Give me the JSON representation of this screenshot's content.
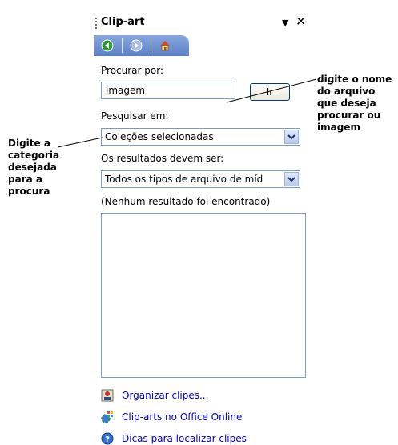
{
  "pane": {
    "title": "Clip-art",
    "dropdown_arrow": "▼",
    "close": "✕",
    "nav": [
      "back-icon",
      "forward-icon",
      "home-icon"
    ],
    "search_for_label": "Procurar por:",
    "search_for_value": "imagem",
    "go_label": "Ir",
    "search_in_label": "Pesquisar em:",
    "search_in_value": "Coleções selecionadas",
    "results_type_label": "Os resultados devem ser:",
    "results_type_value": "Todos os tipos de arquivo de míd",
    "status": "(Nenhum resultado foi encontrado)",
    "links": [
      {
        "label": "Organizar clipes...",
        "icon": "organize-clips-icon"
      },
      {
        "label": "Clip-arts no Office Online",
        "icon": "office-online-icon"
      },
      {
        "label": "Dicas para localizar clipes",
        "icon": "help-icon"
      }
    ]
  },
  "annotations": {
    "right": [
      "digite o nome",
      "do arquivo",
      "que deseja",
      "procurar ou",
      "imagem"
    ],
    "left": [
      "Digite a",
      "categoria",
      "desejada",
      "para a",
      "procura"
    ]
  }
}
